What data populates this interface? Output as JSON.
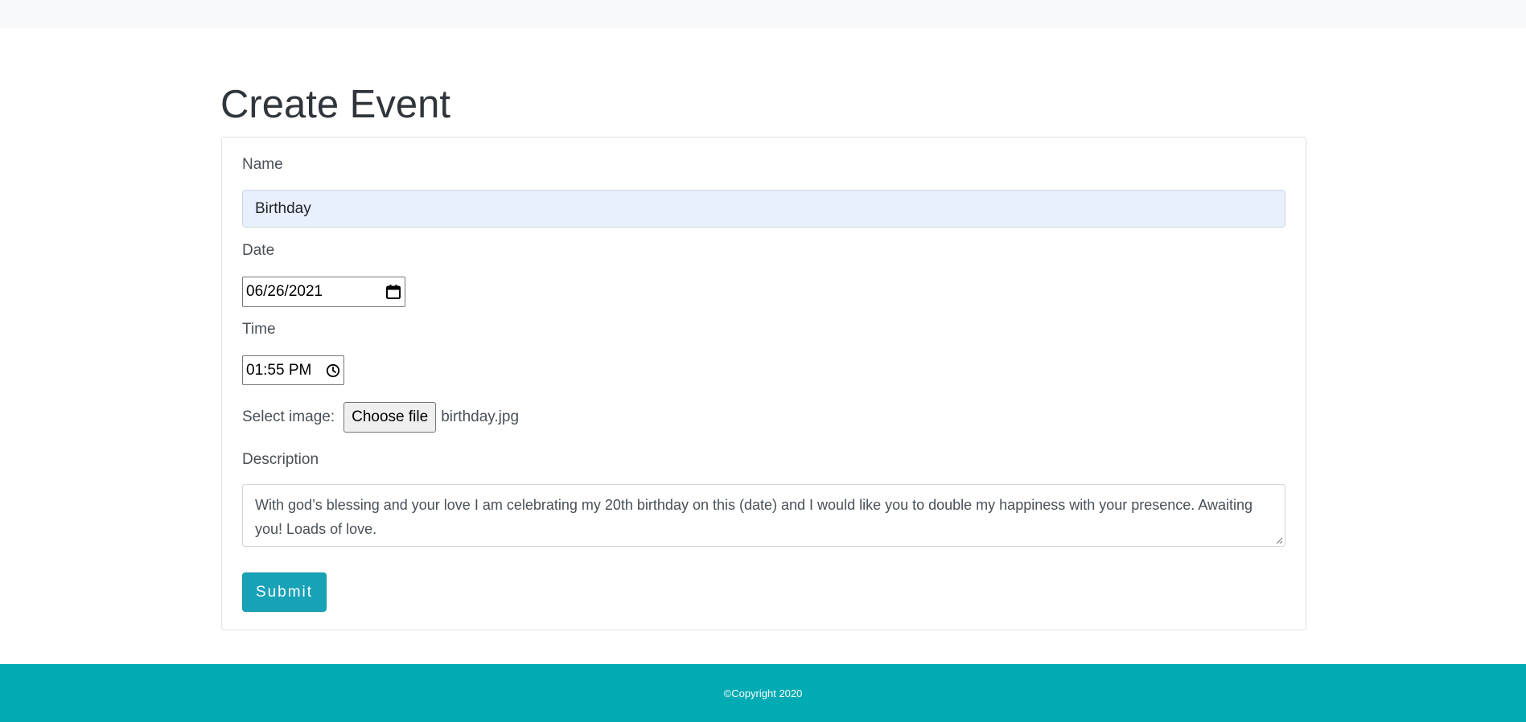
{
  "page": {
    "title": "Create Event"
  },
  "form": {
    "name_label": "Name",
    "name_value": "Birthday",
    "date_label": "Date",
    "date_value": "06/26/2021",
    "time_label": "Time",
    "time_value": "01:55 PM",
    "image_label": "Select image:",
    "choose_file_label": "Choose file",
    "file_name": "birthday.jpg",
    "description_label": "Description",
    "description_value": "With god’s blessing and your love I am celebrating my 20th birthday on this (date) and I would like you to double my happiness with your presence. Awaiting you! Loads of love.",
    "submit_label": "Submit"
  },
  "footer": {
    "copyright": "©Copyright 2020"
  },
  "colors": {
    "accent": "#17a2b8",
    "footer_bg": "#00abb3",
    "autofill_bg": "#e8f0fe"
  },
  "icons": {
    "date": "calendar-icon",
    "time": "clock-icon"
  }
}
